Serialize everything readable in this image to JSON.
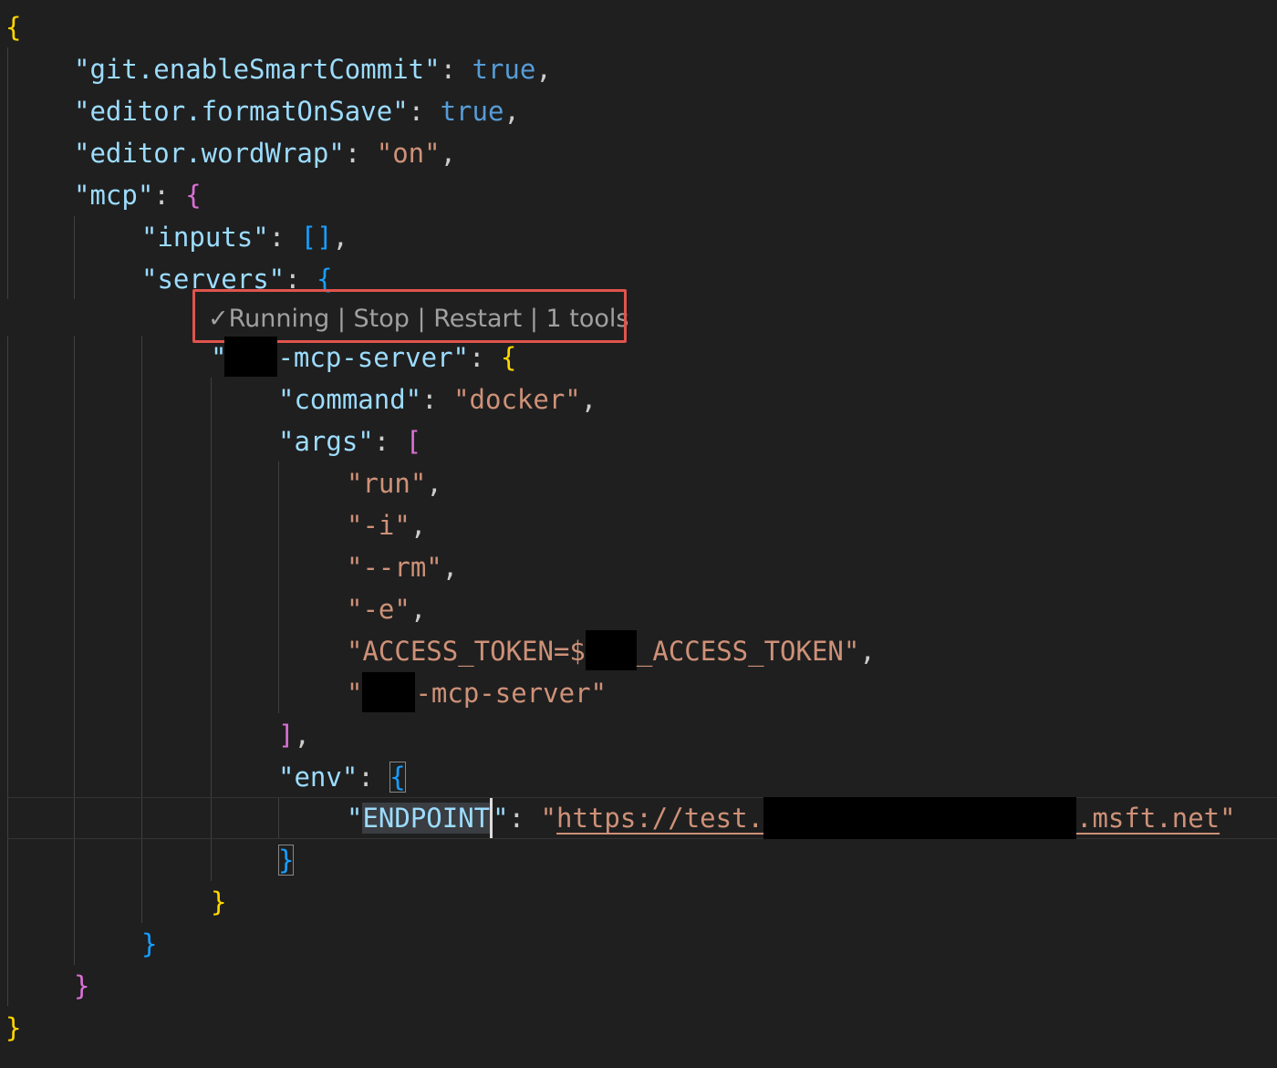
{
  "codelens": {
    "check": "✓",
    "running": "Running",
    "sep": " | ",
    "stop": "Stop",
    "restart": "Restart",
    "tools": "1 tools"
  },
  "json": {
    "smart_commit_key": "\"git.enableSmartCommit\"",
    "smart_commit_val": "true",
    "format_on_save_key": "\"editor.formatOnSave\"",
    "format_on_save_val": "true",
    "word_wrap_key": "\"editor.wordWrap\"",
    "word_wrap_val": "\"on\"",
    "mcp_key": "\"mcp\"",
    "inputs_key": "\"inputs\"",
    "servers_key": "\"servers\"",
    "server_name_suffix": "-mcp-server\"",
    "command_key": "\"command\"",
    "command_val": "\"docker\"",
    "args_key": "\"args\"",
    "arg_run": "\"run\"",
    "arg_i": "\"-i\"",
    "arg_rm": "\"--rm\"",
    "arg_e": "\"-e\"",
    "arg_token_prefix": "\"ACCESS_TOKEN=$",
    "arg_token_suffix": "_ACCESS_TOKEN\"",
    "arg_image_suffix": "-mcp-server\"",
    "env_key": "\"env\"",
    "endpoint_key": "ENDPOINT",
    "endpoint_val_prefix": "https://test.",
    "endpoint_val_suffix": ".msft.net"
  }
}
